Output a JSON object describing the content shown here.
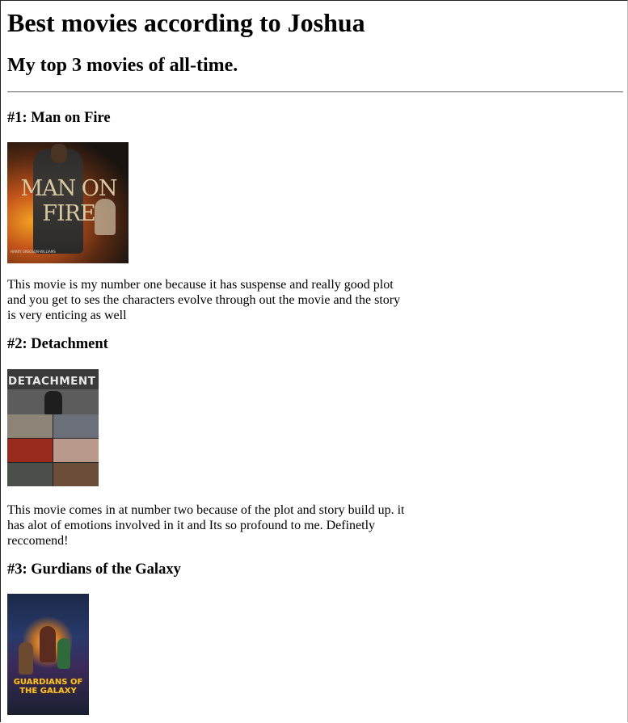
{
  "page": {
    "title": "Best movies according to Joshua",
    "subtitle": "My top 3 movies of all-time."
  },
  "movies": [
    {
      "heading": "#1: Man on Fire",
      "poster": {
        "title_text": "MAN ON FIRE",
        "credit_text": "HARRY GREGSON-WILLIAMS",
        "palette": [
          "#f2a024",
          "#c4541a",
          "#1a1410"
        ]
      },
      "description": "This movie is my number one because it has suspense and really good plot and you get to ses the characters evolve through out the movie and the story is very enticing as well"
    },
    {
      "heading": "#2: Detachment",
      "poster": {
        "title_text": "DETACHMENT",
        "palette": [
          "#3a3a3a",
          "#9a2a1d",
          "#8b8477"
        ]
      },
      "description": "This movie comes in at number two because of the plot and story build up. it has alot of emotions involved in it and Its so profound to me. Definetly reccomend!"
    },
    {
      "heading": "#3: Gurdians of the Galaxy",
      "poster": {
        "title_text": "GUARDIANS OF THE GALAXY",
        "palette": [
          "#1b2847",
          "#f3c230",
          "#3c2a5a"
        ]
      }
    }
  ]
}
